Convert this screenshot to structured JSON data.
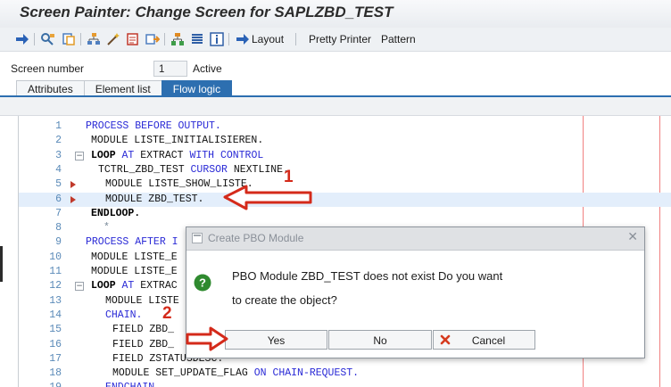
{
  "window": {
    "title": "Screen Painter: Change Screen for SAPLZBD_TEST"
  },
  "toolbar": {
    "layout_label": "Layout",
    "pretty_printer_label": "Pretty Printer",
    "pattern_label": "Pattern",
    "icons": [
      "back-icon",
      "where-used-icon",
      "copy-icon",
      "hierarchy-icon",
      "magic-wand-icon",
      "display-change-icon",
      "activate-icon",
      "structure-icon",
      "list-icon",
      "info-icon",
      "layout-arrow-icon"
    ]
  },
  "screen": {
    "number_label": "Screen number",
    "number_value": "1",
    "status": "Active"
  },
  "tabs": [
    "Attributes",
    "Element list",
    "Flow logic"
  ],
  "active_tab": "Flow logic",
  "editor": {
    "lines": [
      {
        "num": "1",
        "parts": [
          [
            "kw",
            "PROCESS BEFORE OUTPUT."
          ]
        ]
      },
      {
        "num": "2",
        "parts": [
          [
            "",
            "MODULE LISTE_INITIALISIEREN."
          ]
        ]
      },
      {
        "num": "3",
        "parts": [
          [
            "kb",
            "LOOP"
          ],
          [
            "kw",
            " AT "
          ],
          [
            "",
            "EXTRACT "
          ],
          [
            "kw",
            "WITH CONTROL"
          ]
        ]
      },
      {
        "num": "4",
        "parts": [
          [
            "",
            "TCTRL_ZBD_TEST "
          ],
          [
            "kw",
            "CURSOR "
          ],
          [
            "",
            "NEXTLINE."
          ]
        ]
      },
      {
        "num": "5",
        "parts": [
          [
            "",
            "MODULE LISTE_SHOW_LISTE."
          ]
        ]
      },
      {
        "num": "6",
        "parts": [
          [
            "",
            "MODULE ZBD_TEST."
          ]
        ]
      },
      {
        "num": "7",
        "parts": [
          [
            "kb",
            "ENDLOOP."
          ]
        ]
      },
      {
        "num": "8",
        "parts": [
          [
            "cm",
            "*"
          ]
        ]
      },
      {
        "num": "9",
        "parts": [
          [
            "kw",
            "PROCESS AFTER I"
          ]
        ]
      },
      {
        "num": "10",
        "parts": [
          [
            "",
            "MODULE LISTE_E"
          ]
        ]
      },
      {
        "num": "11",
        "parts": [
          [
            "",
            "MODULE LISTE_E"
          ]
        ]
      },
      {
        "num": "12",
        "parts": [
          [
            "kb",
            "LOOP"
          ],
          [
            "kw",
            " AT "
          ],
          [
            "",
            "EXTRAC"
          ]
        ]
      },
      {
        "num": "13",
        "parts": [
          [
            "",
            "MODULE LISTE"
          ]
        ]
      },
      {
        "num": "14",
        "parts": [
          [
            "kw",
            "CHAIN."
          ]
        ]
      },
      {
        "num": "15",
        "parts": [
          [
            "",
            "FIELD ZBD_"
          ]
        ]
      },
      {
        "num": "16",
        "parts": [
          [
            "",
            "FIELD ZBD_"
          ]
        ]
      },
      {
        "num": "17",
        "parts": [
          [
            "",
            "FIELD ZSTATUSDESC."
          ]
        ]
      },
      {
        "num": "18",
        "parts": [
          [
            "",
            "MODULE SET_UPDATE_FLAG "
          ],
          [
            "kw",
            "ON CHAIN-REQUEST."
          ]
        ]
      },
      {
        "num": "19",
        "parts": [
          [
            "kw",
            "ENDCHAIN."
          ]
        ]
      }
    ]
  },
  "dialog": {
    "title": "Create PBO Module",
    "message_line1": "PBO Module ZBD_TEST does not exist Do you want",
    "message_line2": "to create the object?",
    "yes_label": "Yes",
    "no_label": "No",
    "cancel_label": "Cancel",
    "close_glyph": "✕"
  },
  "annotations": {
    "arrow1_label": "1",
    "arrow2_label": "2",
    "color": "#d42a1a"
  }
}
